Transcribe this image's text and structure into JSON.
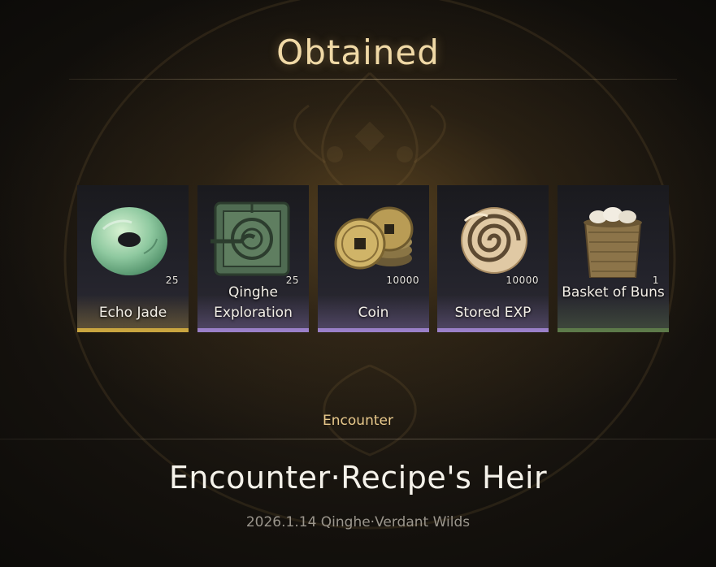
{
  "header": {
    "title": "Obtained"
  },
  "colors": {
    "title": "#f0d9a6",
    "rarity_gold": "#c9a540",
    "rarity_purple": "#9a80c8",
    "rarity_green": "#5d7a4a"
  },
  "items": [
    {
      "name": "Echo Jade",
      "quantity": "25",
      "icon": "jade-ring-icon",
      "rarity": "gold"
    },
    {
      "name": "Qinghe Exploration",
      "quantity": "25",
      "icon": "map-tile-icon",
      "rarity": "purple"
    },
    {
      "name": "Coin",
      "quantity": "10000",
      "icon": "coin-stack-icon",
      "rarity": "purple"
    },
    {
      "name": "Stored EXP",
      "quantity": "10000",
      "icon": "spiral-jade-icon",
      "rarity": "purple"
    },
    {
      "name": "Basket of Buns",
      "quantity": "1",
      "icon": "bun-basket-icon",
      "rarity": "green"
    }
  ],
  "event": {
    "category": "Encounter",
    "title": "Encounter·Recipe's Heir",
    "meta": "2026.1.14 Qinghe·Verdant Wilds"
  }
}
